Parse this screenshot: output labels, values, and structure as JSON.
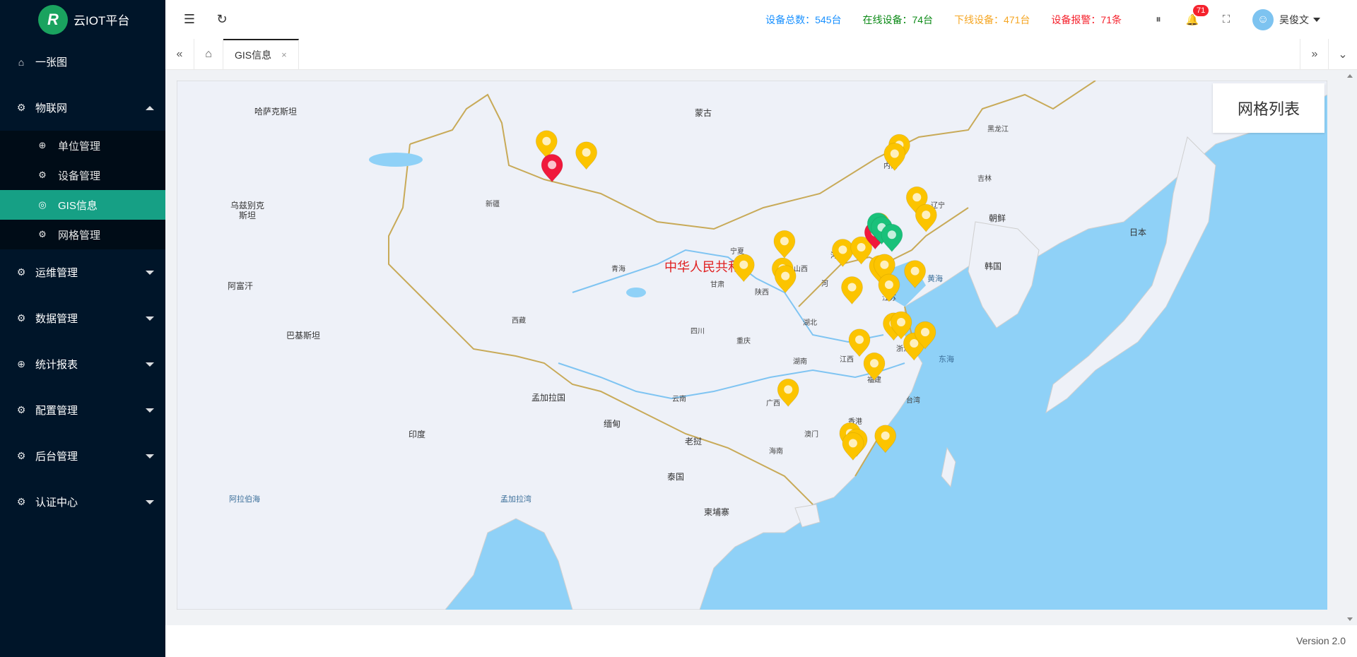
{
  "app": {
    "name": "云IOT平台",
    "logo_letter": "R"
  },
  "sidebar": {
    "items": [
      {
        "label": "一张图",
        "icon": "home-icon"
      },
      {
        "label": "物联网",
        "icon": "gear-icon",
        "open": true,
        "children": [
          {
            "label": "单位管理",
            "icon": "globe-icon"
          },
          {
            "label": "设备管理",
            "icon": "gear-icon"
          },
          {
            "label": "GIS信息",
            "icon": "location-icon",
            "active": true
          },
          {
            "label": "网格管理",
            "icon": "gear-icon"
          }
        ]
      },
      {
        "label": "运维管理",
        "icon": "gear-icon"
      },
      {
        "label": "数据管理",
        "icon": "gear-icon"
      },
      {
        "label": "统计报表",
        "icon": "globe-icon"
      },
      {
        "label": "配置管理",
        "icon": "gear-icon"
      },
      {
        "label": "后台管理",
        "icon": "gear-icon"
      },
      {
        "label": "认证中心",
        "icon": "gear-icon"
      }
    ]
  },
  "header": {
    "stats": {
      "total": "设备总数：545台",
      "online": "在线设备：74台",
      "offline": "下线设备：471台",
      "alarm": "设备报警：71条"
    },
    "notification_count": "71",
    "user_name": "吴俊文"
  },
  "tabs": [
    {
      "label": "GIS信息",
      "close": "×"
    }
  ],
  "map": {
    "grid_list_button": "网格列表",
    "country_label": "中华人民共和",
    "labels": {
      "kazakhstan": "哈萨克斯坦",
      "mongolia": "蒙古",
      "uzbekistan": "乌兹别克斯坦",
      "afghanistan": "阿富汗",
      "pakistan": "巴基斯坦",
      "india": "印度",
      "bangladesh": "孟加拉国",
      "myanmar": "缅甸",
      "laos": "老挝",
      "thailand": "泰国",
      "cambodia": "柬埔寨",
      "arabian_sea": "阿拉伯海",
      "bay_of_bengal": "孟加拉湾",
      "korea": "韩国",
      "north_korea": "朝鲜",
      "japan": "日本",
      "yellow_sea": "黄海",
      "east_sea": "东海",
      "xinjiang": "新疆",
      "xizang": "西藏",
      "qinghai": "青海",
      "gansu": "甘肃",
      "ningxia": "宁夏",
      "shaanxi": "陕西",
      "shanxi": "山西",
      "hebei": "河北",
      "shandong": "山东",
      "jiangsu": "江苏",
      "zhejiang": "浙江",
      "hubei": "湖北",
      "hunan": "湖南",
      "sichuan": "四川",
      "chongqing": "重庆",
      "yunnan": "云南",
      "guangxi": "广西",
      "jiangxi": "江西",
      "fujian": "福建",
      "taiwan": "台湾",
      "hongkong": "香港",
      "macau": "澳门",
      "hainan": "海南",
      "heilongjiang": "黑龙江",
      "jilin": "吉林",
      "liaoning": "辽宁",
      "neimenggu": "内蒙",
      "he_nan_partial": "河"
    },
    "marker_colors": {
      "offline": "#fcc400",
      "alarm": "#f0193c",
      "online": "#19c17a"
    },
    "markers": [
      {
        "status": "offline",
        "lng": 80.5,
        "lat": 46.5
      },
      {
        "status": "alarm",
        "lng": 81.1,
        "lat": 44.6
      },
      {
        "status": "offline",
        "lng": 84.8,
        "lat": 45.6
      },
      {
        "status": "offline",
        "lng": 101.8,
        "lat": 36.6
      },
      {
        "status": "offline",
        "lng": 106.2,
        "lat": 38.5
      },
      {
        "status": "offline",
        "lng": 106.0,
        "lat": 36.3
      },
      {
        "status": "offline",
        "lng": 106.3,
        "lat": 35.7
      },
      {
        "status": "offline",
        "lng": 112.5,
        "lat": 37.8
      },
      {
        "status": "offline",
        "lng": 113.5,
        "lat": 34.8
      },
      {
        "status": "offline",
        "lng": 114.5,
        "lat": 38.0
      },
      {
        "status": "offline",
        "lng": 116.4,
        "lat": 39.9
      },
      {
        "status": "alarm",
        "lng": 116.0,
        "lat": 39.2
      },
      {
        "status": "online",
        "lng": 116.3,
        "lat": 39.9
      },
      {
        "status": "online",
        "lng": 116.7,
        "lat": 39.6
      },
      {
        "status": "online",
        "lng": 117.8,
        "lat": 39.0
      },
      {
        "status": "offline",
        "lng": 116.5,
        "lat": 36.5
      },
      {
        "status": "offline",
        "lng": 117.0,
        "lat": 36.6
      },
      {
        "status": "offline",
        "lng": 117.5,
        "lat": 35.0
      },
      {
        "status": "offline",
        "lng": 120.3,
        "lat": 36.1
      },
      {
        "status": "offline",
        "lng": 118.0,
        "lat": 31.9
      },
      {
        "status": "offline",
        "lng": 118.8,
        "lat": 32.0
      },
      {
        "status": "offline",
        "lng": 120.2,
        "lat": 30.3
      },
      {
        "status": "offline",
        "lng": 121.4,
        "lat": 31.2
      },
      {
        "status": "offline",
        "lng": 114.3,
        "lat": 30.6
      },
      {
        "status": "offline",
        "lng": 115.9,
        "lat": 28.7
      },
      {
        "status": "offline",
        "lng": 106.6,
        "lat": 26.6
      },
      {
        "status": "offline",
        "lng": 113.3,
        "lat": 23.1
      },
      {
        "status": "offline",
        "lng": 114.0,
        "lat": 22.6
      },
      {
        "status": "offline",
        "lng": 113.6,
        "lat": 22.3
      },
      {
        "status": "offline",
        "lng": 117.1,
        "lat": 22.9
      },
      {
        "status": "offline",
        "lng": 120.5,
        "lat": 42.0
      },
      {
        "status": "offline",
        "lng": 121.5,
        "lat": 40.6
      },
      {
        "status": "offline",
        "lng": 118.6,
        "lat": 46.2
      },
      {
        "status": "offline",
        "lng": 118.1,
        "lat": 45.5
      }
    ]
  },
  "footer": {
    "version": "Version 2.0"
  }
}
